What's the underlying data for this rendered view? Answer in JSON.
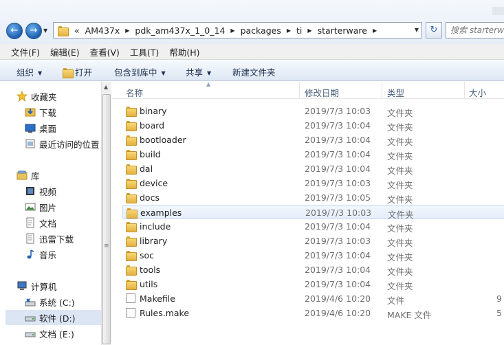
{
  "nav_buttons": {
    "back_glyph": "←",
    "forward_glyph": "→",
    "history_glyph": "▼",
    "refresh_glyph": "↻"
  },
  "address": {
    "overflow": "«",
    "crumbs": [
      "AM437x",
      "pdk_am437x_1_0_14",
      "packages",
      "ti",
      "starterware"
    ],
    "separator": "▶",
    "dropdown": "▼"
  },
  "search": {
    "placeholder": "搜索 starterware"
  },
  "menu": [
    "文件(F)",
    "编辑(E)",
    "查看(V)",
    "工具(T)",
    "帮助(H)"
  ],
  "commands": {
    "organize": "组织",
    "open": "打开",
    "include_in_library": "包含到库中",
    "share": "共享",
    "new_folder": "新建文件夹",
    "arrow": "▼"
  },
  "nav": {
    "favorites": {
      "label": "收藏夹",
      "icon": "star-icon"
    },
    "downloads": {
      "label": "下载",
      "icon": "downloads-icon"
    },
    "desktop": {
      "label": "桌面",
      "icon": "desktop-icon"
    },
    "recent": {
      "label": "最近访问的位置",
      "icon": "recent-places-icon"
    },
    "libraries": {
      "label": "库",
      "icon": "library-icon"
    },
    "videos": {
      "label": "视频",
      "icon": "video-icon"
    },
    "pictures": {
      "label": "图片",
      "icon": "picture-icon"
    },
    "documents": {
      "label": "文档",
      "icon": "document-icon"
    },
    "thunder": {
      "label": "迅雷下载",
      "icon": "thunder-download-icon"
    },
    "music": {
      "label": "音乐",
      "icon": "music-icon"
    },
    "computer": {
      "label": "计算机",
      "icon": "computer-icon"
    },
    "drive_c": {
      "label": "系统 (C:)",
      "icon": "drive-icon"
    },
    "drive_d": {
      "label": "软件 (D:)",
      "icon": "drive-icon",
      "selected": true
    },
    "drive_e": {
      "label": "文档 (E:)",
      "icon": "drive-icon"
    }
  },
  "columns": {
    "name": "名称",
    "date": "修改日期",
    "type": "类型",
    "size": "大小"
  },
  "files": [
    {
      "name": "binary",
      "date": "2019/7/3 10:03",
      "type": "文件夹",
      "size": "",
      "kind": "folder"
    },
    {
      "name": "board",
      "date": "2019/7/3 10:04",
      "type": "文件夹",
      "size": "",
      "kind": "folder"
    },
    {
      "name": "bootloader",
      "date": "2019/7/3 10:04",
      "type": "文件夹",
      "size": "",
      "kind": "folder"
    },
    {
      "name": "build",
      "date": "2019/7/3 10:04",
      "type": "文件夹",
      "size": "",
      "kind": "folder"
    },
    {
      "name": "dal",
      "date": "2019/7/3 10:04",
      "type": "文件夹",
      "size": "",
      "kind": "folder"
    },
    {
      "name": "device",
      "date": "2019/7/3 10:03",
      "type": "文件夹",
      "size": "",
      "kind": "folder"
    },
    {
      "name": "docs",
      "date": "2019/7/3 10:05",
      "type": "文件夹",
      "size": "",
      "kind": "folder"
    },
    {
      "name": "examples",
      "date": "2019/7/3 10:03",
      "type": "文件夹",
      "size": "",
      "kind": "folder",
      "hot": true
    },
    {
      "name": "include",
      "date": "2019/7/3 10:04",
      "type": "文件夹",
      "size": "",
      "kind": "folder"
    },
    {
      "name": "library",
      "date": "2019/7/3 10:03",
      "type": "文件夹",
      "size": "",
      "kind": "folder"
    },
    {
      "name": "soc",
      "date": "2019/7/3 10:04",
      "type": "文件夹",
      "size": "",
      "kind": "folder"
    },
    {
      "name": "tools",
      "date": "2019/7/3 10:04",
      "type": "文件夹",
      "size": "",
      "kind": "folder"
    },
    {
      "name": "utils",
      "date": "2019/7/3 10:04",
      "type": "文件夹",
      "size": "",
      "kind": "folder"
    },
    {
      "name": "Makefile",
      "date": "2019/4/6 10:20",
      "type": "文件",
      "size": "9",
      "kind": "file"
    },
    {
      "name": "Rules.make",
      "date": "2019/4/6 10:20",
      "type": "MAKE 文件",
      "size": "5",
      "kind": "file"
    }
  ],
  "colors": {
    "accent": "#2d67b3",
    "hover_row": "#e5eefb",
    "selected_nav": "#dbe5f3"
  }
}
